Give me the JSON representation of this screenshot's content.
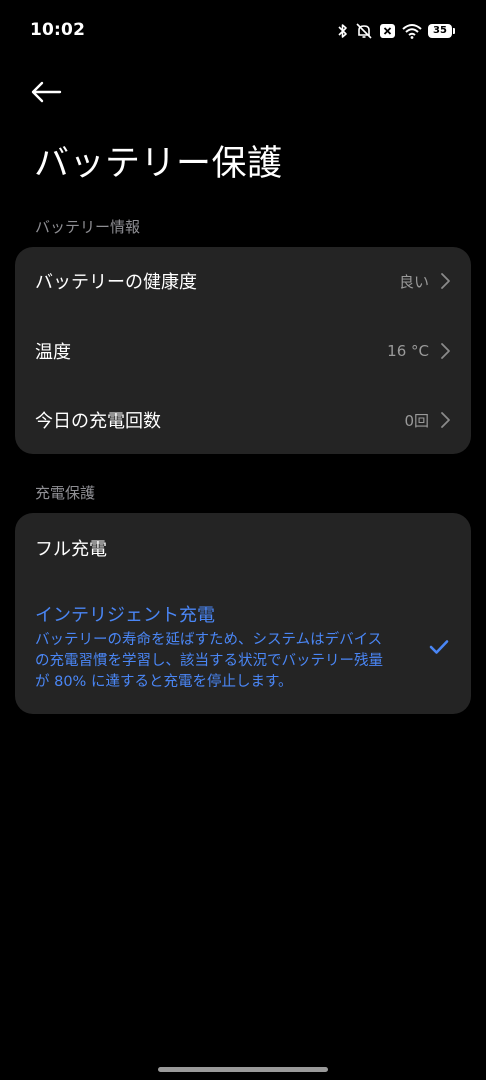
{
  "status_bar": {
    "time": "10:02",
    "battery_level": "35",
    "icons": [
      "bluetooth-icon",
      "mute-icon",
      "no-sim-icon",
      "wifi-icon",
      "battery-icon"
    ]
  },
  "header": {
    "back_icon": "arrow-left-icon",
    "title": "バッテリー保護"
  },
  "battery_info": {
    "section_title": "バッテリー情報",
    "items": [
      {
        "label": "バッテリーの健康度",
        "value": "良い"
      },
      {
        "label": "温度",
        "value": "16 °C"
      },
      {
        "label": "今日の充電回数",
        "value": "0回"
      }
    ]
  },
  "charge_protection": {
    "section_title": "充電保護",
    "full_charge": {
      "label": "フル充電"
    },
    "intelligent_charge": {
      "label": "インテリジェント充電",
      "description_lines": [
        "バッテリーの寿命を延ばすため、システムはデバイス",
        "の充電習慣を学習し、該当する状況でバッテリー残量",
        "が 80% に達すると充電を停止します。"
      ],
      "selected": true
    }
  },
  "colors": {
    "background": "#000000",
    "card": "#242424",
    "accent": "#4a86f5",
    "secondary_text": "#9a9a9a"
  }
}
